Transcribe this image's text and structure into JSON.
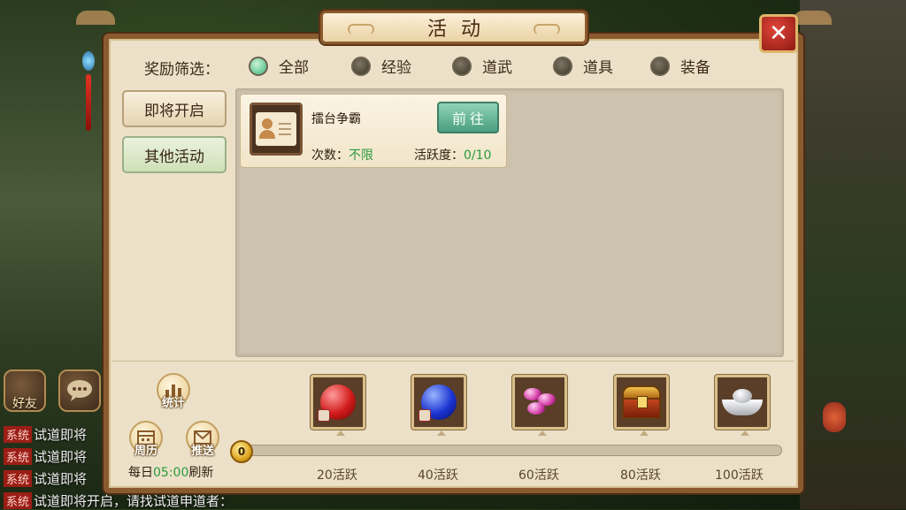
{
  "window": {
    "title": "活动",
    "close_symbol": "✕"
  },
  "filter": {
    "label": "奖励筛选：",
    "options": [
      {
        "label": "全部",
        "selected": true
      },
      {
        "label": "经验",
        "selected": false
      },
      {
        "label": "道武",
        "selected": false
      },
      {
        "label": "道具",
        "selected": false
      },
      {
        "label": "装备",
        "selected": false
      }
    ]
  },
  "categories": [
    {
      "label": "即将开启",
      "active": false
    },
    {
      "label": "其他活动",
      "active": true
    }
  ],
  "activities": [
    {
      "name": "擂台争霸",
      "go_label": "前往",
      "count_label": "次数：",
      "count_value": "不限",
      "activity_label": "活跃度：",
      "activity_value": "0/10",
      "icon": "id-card-icon"
    }
  ],
  "bottom": {
    "stats_label": "统计",
    "calendar_label": "周历",
    "push_label": "推送",
    "refresh_prefix": "每日",
    "refresh_time": "05:00",
    "refresh_suffix": "刷新",
    "current_points": "0",
    "progress_fraction": 0,
    "milestones": [
      {
        "label": "20活跃",
        "reward_icon": "red-orb-icon"
      },
      {
        "label": "40活跃",
        "reward_icon": "blue-orb-icon"
      },
      {
        "label": "60活跃",
        "reward_icon": "pink-gems-icon"
      },
      {
        "label": "80活跃",
        "reward_icon": "treasure-chest-icon"
      },
      {
        "label": "100活跃",
        "reward_icon": "silver-ingot-icon"
      }
    ]
  },
  "side": {
    "friends_label": "好友",
    "chat_lines": [
      {
        "tag": "系统",
        "text": "试道即将"
      },
      {
        "tag": "系统",
        "text": "试道即将"
      },
      {
        "tag": "系统",
        "text": "试道即将"
      },
      {
        "tag": "系统",
        "text": "试道即将开启，请找试道申道者："
      }
    ]
  },
  "colors": {
    "accent_green": "#2a9a3c",
    "panel_bg": "#ece1c8",
    "close_red": "#c4281c"
  }
}
